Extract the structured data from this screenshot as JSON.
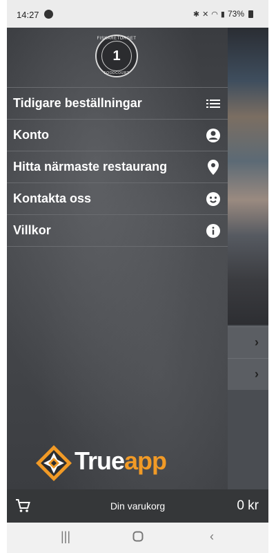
{
  "status_bar": {
    "time": "14:27",
    "battery": "73%",
    "icons": [
      "spotify-icon",
      "bluetooth-icon",
      "mute-icon",
      "wifi-icon",
      "signal-icon",
      "battery-icon"
    ]
  },
  "drawer": {
    "logo": {
      "number": "1",
      "top_text": "FISKARETORGET",
      "bottom_text": "FOODCOURT"
    },
    "menu": [
      {
        "label": "Tidigare beställningar",
        "icon": "list-icon"
      },
      {
        "label": "Konto",
        "icon": "account-icon"
      },
      {
        "label": "Hitta närmaste restaurang",
        "icon": "location-pin-icon"
      },
      {
        "label": "Kontakta oss",
        "icon": "chat-face-icon"
      },
      {
        "label": "Villkor",
        "icon": "info-icon"
      }
    ],
    "brand": {
      "part1": "True",
      "part2": "app"
    }
  },
  "cart": {
    "label": "Din varukorg",
    "total": "0 kr"
  },
  "colors": {
    "brand_orange": "#f19a26",
    "drawer_bg": "#3f4145",
    "cart_bar_bg": "#353739"
  }
}
